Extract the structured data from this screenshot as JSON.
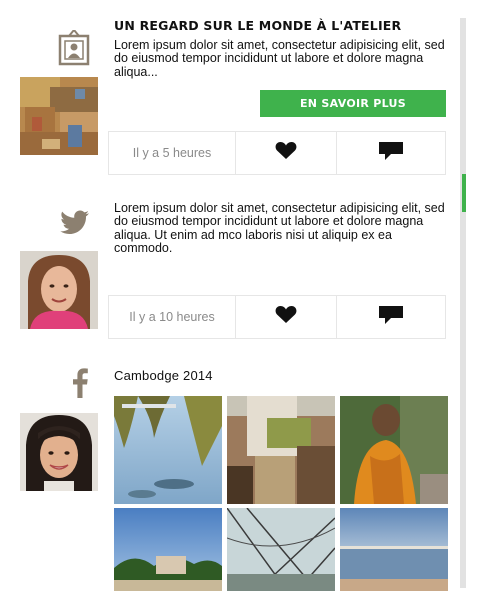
{
  "posts": [
    {
      "source_icon": "portfolio-icon",
      "title": "UN REGARD SUR LE MONDE À L'ATELIER",
      "text": "Lorem ipsum dolor sit amet, consectetur adipisicing elit, sed do eiusmod tempor incididunt ut labore et dolore magna aliqua...",
      "cta": "EN SAVOIR PLUS",
      "time": "Il y a 5 heures"
    },
    {
      "source_icon": "twitter-icon",
      "text": "Lorem ipsum dolor sit amet, consectetur adipisicing elit, sed do eiusmod tempor incididunt ut labore et dolore magna aliqua. Ut enim ad mco laboris nisi ut aliquip ex ea commodo.",
      "time": "Il y a 10 heures"
    },
    {
      "source_icon": "facebook-icon",
      "title": "Cambodge 2014"
    }
  ],
  "colors": {
    "accent": "#3fb24c",
    "icon_gray": "#8c8070"
  }
}
